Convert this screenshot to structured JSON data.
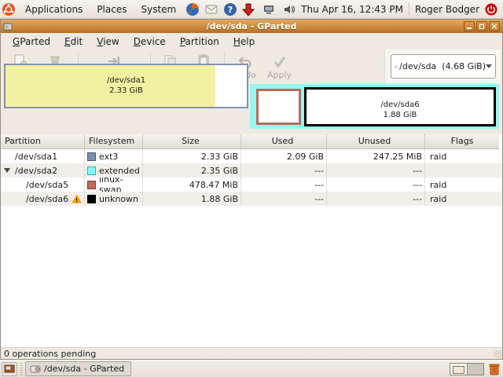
{
  "colors": {
    "accent": "#D78A3D",
    "ext3": "#7590AE",
    "extended": "#7DFCFE",
    "linux_swap": "#C1665A",
    "unknown": "#000000"
  },
  "panel": {
    "menus": {
      "applications": "Applications",
      "places": "Places",
      "system": "System"
    },
    "clock": "Thu Apr 16, 12:43 PM",
    "user": "Roger Bodger"
  },
  "window": {
    "title": "/dev/sda - GParted",
    "menu": {
      "items": [
        {
          "u": "G",
          "rest": "Parted"
        },
        {
          "u": "E",
          "rest": "dit"
        },
        {
          "u": "V",
          "rest": "iew"
        },
        {
          "u": "D",
          "rest": "evice"
        },
        {
          "u": "P",
          "rest": "artition"
        },
        {
          "u": "H",
          "rest": "elp"
        }
      ]
    }
  },
  "toolbar": {
    "buttons": [
      {
        "label": "New"
      },
      {
        "label": "Delete"
      },
      {
        "label": "Resize/Move"
      },
      {
        "label": "Copy"
      },
      {
        "label": "Paste"
      },
      {
        "label": "Undo"
      },
      {
        "label": "Apply"
      }
    ],
    "device_selector": "/dev/sda  (4.68 GiB)"
  },
  "disk": {
    "sda1": {
      "name": "/dev/sda1",
      "size": "2.33 GiB"
    },
    "sda6": {
      "name": "/dev/sda6",
      "size": "1.88 GiB"
    }
  },
  "table": {
    "headers": [
      "Partition",
      "Filesystem",
      "Size",
      "Used",
      "Unused",
      "Flags"
    ],
    "rows": [
      {
        "partition": "/dev/sda1",
        "fs": "ext3",
        "fs_color": "#7590AE",
        "size": "2.33 GiB",
        "used": "2.09 GiB",
        "unused": "247.25 MiB",
        "flags": "raid"
      },
      {
        "partition": "/dev/sda2",
        "fs": "extended",
        "fs_color": "#7DFCFE",
        "size": "2.35 GiB",
        "used": "---",
        "unused": "---",
        "flags": ""
      },
      {
        "partition": "/dev/sda5",
        "fs": "linux-swap",
        "fs_color": "#C1665A",
        "size": "478.47 MiB",
        "used": "---",
        "unused": "---",
        "flags": "raid"
      },
      {
        "partition": "/dev/sda6",
        "fs": "unknown",
        "fs_color": "#000000",
        "size": "1.88 GiB",
        "used": "---",
        "unused": "---",
        "flags": "raid"
      }
    ]
  },
  "status": "0 operations pending",
  "taskbar": {
    "task": "/dev/sda - GParted"
  }
}
